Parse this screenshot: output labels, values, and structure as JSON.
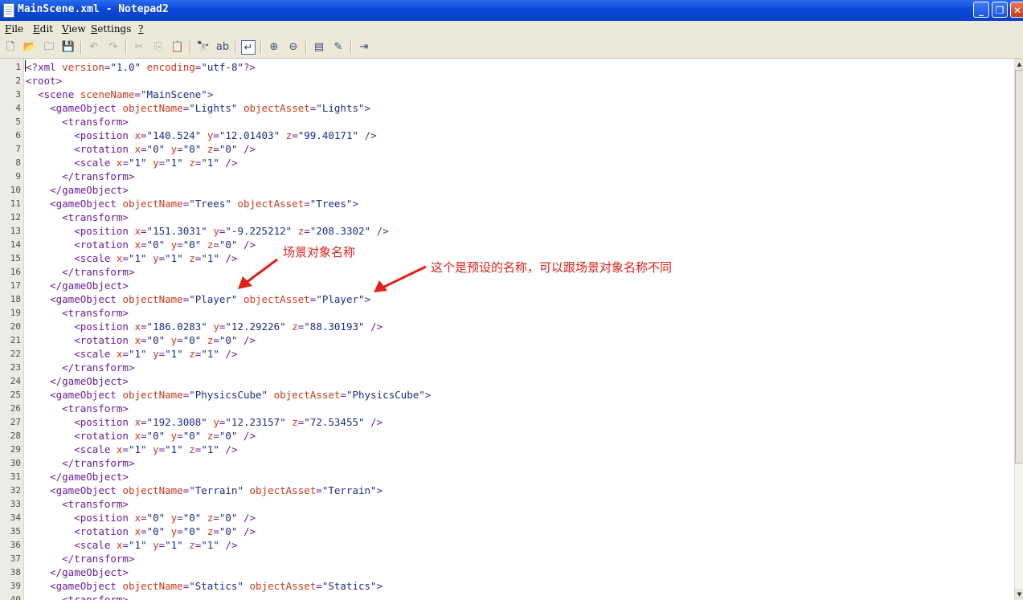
{
  "window": {
    "title": "MainScene.xml - Notepad2",
    "min": "_",
    "max": "❐",
    "close": "✕"
  },
  "menu": [
    {
      "key": "F",
      "rest": "ile"
    },
    {
      "key": "E",
      "rest": "dit"
    },
    {
      "key": "V",
      "rest": "iew"
    },
    {
      "key": "S",
      "rest": "ettings"
    },
    {
      "key": "?",
      "rest": ""
    }
  ],
  "toolbar": {
    "icons": [
      {
        "name": "new-icon",
        "glyph": "🗋"
      },
      {
        "name": "open-icon",
        "glyph": "📂"
      },
      {
        "name": "browse-icon",
        "glyph": "🗀"
      },
      {
        "name": "save-icon",
        "glyph": "💾"
      },
      {
        "name": "undo-icon",
        "glyph": "↶"
      },
      {
        "name": "redo-icon",
        "glyph": "↷"
      },
      {
        "name": "cut-icon",
        "glyph": "✂"
      },
      {
        "name": "copy-icon",
        "glyph": "⎘"
      },
      {
        "name": "paste-icon",
        "glyph": "📋"
      },
      {
        "name": "find-icon",
        "glyph": "🔭"
      },
      {
        "name": "replace-icon",
        "glyph": "ab"
      },
      {
        "name": "word-wrap-icon",
        "glyph": "↵"
      },
      {
        "name": "zoom-in-icon",
        "glyph": "⊕"
      },
      {
        "name": "zoom-out-icon",
        "glyph": "⊖"
      },
      {
        "name": "scheme-icon",
        "glyph": "▤"
      },
      {
        "name": "customize-schemes-icon",
        "glyph": "✎"
      },
      {
        "name": "exit-icon",
        "glyph": "⇥"
      }
    ]
  },
  "editor": {
    "lines": [
      "<?xml version=\"1.0\" encoding=\"utf-8\"?>",
      "<root>",
      "  <scene sceneName=\"MainScene\">",
      "    <gameObject objectName=\"Lights\" objectAsset=\"Lights\">",
      "      <transform>",
      "        <position x=\"140.524\" y=\"12.01403\" z=\"99.40171\" />",
      "        <rotation x=\"0\" y=\"0\" z=\"0\" />",
      "        <scale x=\"1\" y=\"1\" z=\"1\" />",
      "      </transform>",
      "    </gameObject>",
      "    <gameObject objectName=\"Trees\" objectAsset=\"Trees\">",
      "      <transform>",
      "        <position x=\"151.3031\" y=\"-9.225212\" z=\"208.3302\" />",
      "        <rotation x=\"0\" y=\"0\" z=\"0\" />",
      "        <scale x=\"1\" y=\"1\" z=\"1\" />",
      "      </transform>",
      "    </gameObject>",
      "    <gameObject objectName=\"Player\" objectAsset=\"Player\">",
      "      <transform>",
      "        <position x=\"186.0283\" y=\"12.29226\" z=\"88.30193\" />",
      "        <rotation x=\"0\" y=\"0\" z=\"0\" />",
      "        <scale x=\"1\" y=\"1\" z=\"1\" />",
      "      </transform>",
      "    </gameObject>",
      "    <gameObject objectName=\"PhysicsCube\" objectAsset=\"PhysicsCube\">",
      "      <transform>",
      "        <position x=\"192.3008\" y=\"12.23157\" z=\"72.53455\" />",
      "        <rotation x=\"0\" y=\"0\" z=\"0\" />",
      "        <scale x=\"1\" y=\"1\" z=\"1\" />",
      "      </transform>",
      "    </gameObject>",
      "    <gameObject objectName=\"Terrain\" objectAsset=\"Terrain\">",
      "      <transform>",
      "        <position x=\"0\" y=\"0\" z=\"0\" />",
      "        <rotation x=\"0\" y=\"0\" z=\"0\" />",
      "        <scale x=\"1\" y=\"1\" z=\"1\" />",
      "      </transform>",
      "    </gameObject>",
      "    <gameObject objectName=\"Statics\" objectAsset=\"Statics\">",
      "      <transform>"
    ]
  },
  "annotations": {
    "scene_object_name": "场景对象名称",
    "prefab_name": "这个是预设的名称，可以跟场景对象名称不同"
  },
  "colors": {
    "tag": "#6a1c9a",
    "attr": "#c83a1a",
    "value": "#1c2c8a",
    "annotation": "#e0201a"
  }
}
